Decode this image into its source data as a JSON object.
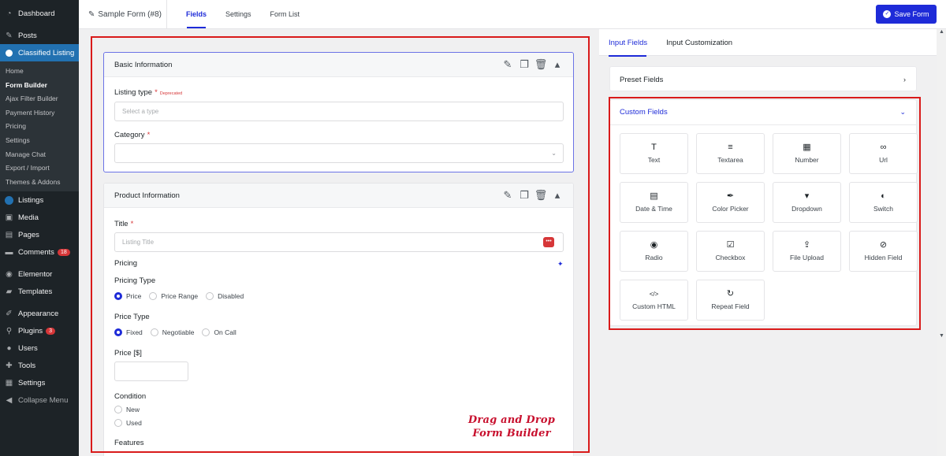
{
  "sidebar": {
    "items_top": [
      {
        "label": "Dashboard",
        "icon": "dashboard-icon"
      },
      {
        "label": "Posts",
        "icon": "pin-icon"
      },
      {
        "label": "Classified Listing",
        "icon": "map-pin-icon"
      }
    ],
    "submenu": [
      "Home",
      "Form Builder",
      "Ajax Filter Builder",
      "Payment History",
      "Pricing",
      "Settings",
      "Manage Chat",
      "Export / Import",
      "Themes & Addons"
    ],
    "items_bottom": [
      {
        "label": "Listings",
        "icon": "map-pin-icon",
        "badge": ""
      },
      {
        "label": "Media",
        "icon": "media-icon",
        "badge": ""
      },
      {
        "label": "Pages",
        "icon": "pages-icon",
        "badge": ""
      },
      {
        "label": "Comments",
        "icon": "comment-icon",
        "badge": "18"
      },
      {
        "label": "Elementor",
        "icon": "elementor-icon",
        "badge": ""
      },
      {
        "label": "Templates",
        "icon": "folder-icon",
        "badge": ""
      },
      {
        "label": "Appearance",
        "icon": "brush-icon",
        "badge": ""
      },
      {
        "label": "Plugins",
        "icon": "plug-icon",
        "badge": "3"
      },
      {
        "label": "Users",
        "icon": "users-icon",
        "badge": ""
      },
      {
        "label": "Tools",
        "icon": "wrench-icon",
        "badge": ""
      },
      {
        "label": "Settings",
        "icon": "settings-icon",
        "badge": ""
      },
      {
        "label": "Collapse Menu",
        "icon": "collapse-icon",
        "badge": ""
      }
    ]
  },
  "header": {
    "form_name": "Sample Form (#8)",
    "tabs": [
      "Fields",
      "Settings",
      "Form List"
    ],
    "save_label": "Save Form"
  },
  "canvas": {
    "basic": {
      "title": "Basic Information",
      "listing_type_label": "Listing type",
      "deprecated": "Deprecated",
      "listing_type_placeholder": "Select a type",
      "category_label": "Category"
    },
    "product": {
      "title": "Product Information",
      "title_label": "Title",
      "title_placeholder": "Listing Title",
      "pricing_label": "Pricing",
      "pricing_type_label": "Pricing Type",
      "pricing_type_options": [
        "Price",
        "Price Range",
        "Disabled"
      ],
      "price_type_label": "Price Type",
      "price_type_options": [
        "Fixed",
        "Negotiable",
        "On Call"
      ],
      "price_label": "Price [$]",
      "condition_label": "Condition",
      "condition_options": [
        "New",
        "Used"
      ],
      "features_label": "Features"
    },
    "annotation": "Drag and Drop Form Builder"
  },
  "panel": {
    "tabs": [
      "Input Fields",
      "Input Customization"
    ],
    "preset_title": "Preset Fields",
    "custom_title": "Custom Fields",
    "fields": [
      {
        "label": "Text",
        "icon": "text-icon"
      },
      {
        "label": "Textarea",
        "icon": "textarea-icon"
      },
      {
        "label": "Number",
        "icon": "number-icon"
      },
      {
        "label": "Url",
        "icon": "link-icon"
      },
      {
        "label": "Date & Time",
        "icon": "calendar-icon"
      },
      {
        "label": "Color Picker",
        "icon": "eyedropper-icon"
      },
      {
        "label": "Dropdown",
        "icon": "dropdown-icon"
      },
      {
        "label": "Switch",
        "icon": "toggle-icon"
      },
      {
        "label": "Radio",
        "icon": "radio-icon"
      },
      {
        "label": "Checkbox",
        "icon": "checkbox-icon"
      },
      {
        "label": "File Upload",
        "icon": "upload-icon"
      },
      {
        "label": "Hidden Field",
        "icon": "eye-slash-icon"
      },
      {
        "label": "Custom HTML",
        "icon": "code-icon"
      },
      {
        "label": "Repeat Field",
        "icon": "repeat-icon"
      }
    ]
  },
  "colors": {
    "accent": "#1e2bd8",
    "annotation": "#d91a1a",
    "wp_dark": "#1d2327"
  }
}
